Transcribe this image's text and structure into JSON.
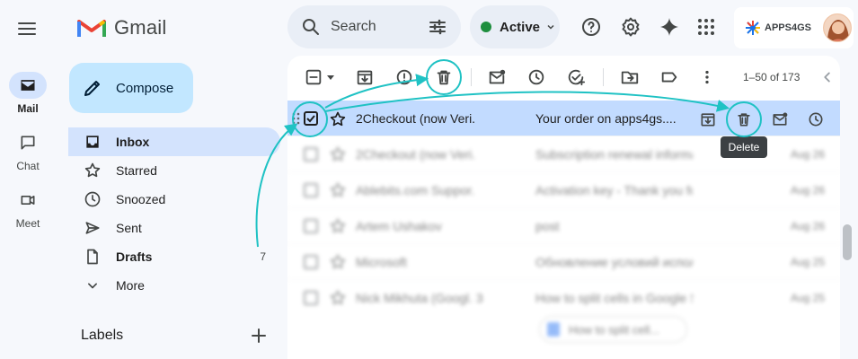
{
  "app": {
    "name": "Gmail"
  },
  "rail": {
    "items": [
      {
        "label": "Mail",
        "icon": "mail-icon",
        "active": true
      },
      {
        "label": "Chat",
        "icon": "chat-icon"
      },
      {
        "label": "Meet",
        "icon": "video-icon"
      }
    ]
  },
  "search": {
    "placeholder": "Search"
  },
  "status": {
    "label": "Active",
    "color": "#1e8e3e"
  },
  "account": {
    "brand": "APPS4GS"
  },
  "compose": {
    "label": "Compose"
  },
  "nav": {
    "items": [
      {
        "label": "Inbox",
        "icon": "inbox-icon",
        "active": true
      },
      {
        "label": "Starred",
        "icon": "star-icon"
      },
      {
        "label": "Snoozed",
        "icon": "clock-icon"
      },
      {
        "label": "Sent",
        "icon": "send-icon"
      },
      {
        "label": "Drafts",
        "icon": "file-icon",
        "count": "7"
      },
      {
        "label": "More",
        "icon": "chevron-down-icon"
      }
    ]
  },
  "labels": {
    "title": "Labels"
  },
  "toolbar": {
    "page_info": "1–50 of 173"
  },
  "emails": [
    {
      "sender": "2Checkout (now Veri.",
      "subject": "Your order on apps4gs....",
      "date": "",
      "selected": true
    },
    {
      "sender": "2Checkout (now Veri.",
      "subject": "Subscription renewal information",
      "date": "Aug 26"
    },
    {
      "sender": "Ablebits.com Suppor.",
      "subject": "Activation key - Thank you for ord...",
      "date": "Aug 26"
    },
    {
      "sender": "Artem Ushakov",
      "subject": "post",
      "date": "Aug 26"
    },
    {
      "sender": "Microsoft",
      "subject": "Обновление условий использов...",
      "date": "Aug 25"
    },
    {
      "sender": "Nick Mikhuta (Googl. 3",
      "subject": "How to split cells in Google Sheets -",
      "date": "Aug 25"
    }
  ],
  "attachment_chip": {
    "label": "How to split cell..."
  },
  "tooltip": {
    "label": "Delete"
  },
  "colors": {
    "accent": "#1fc2c4",
    "selected_row": "#c2dbff",
    "compose": "#c2e7ff"
  }
}
